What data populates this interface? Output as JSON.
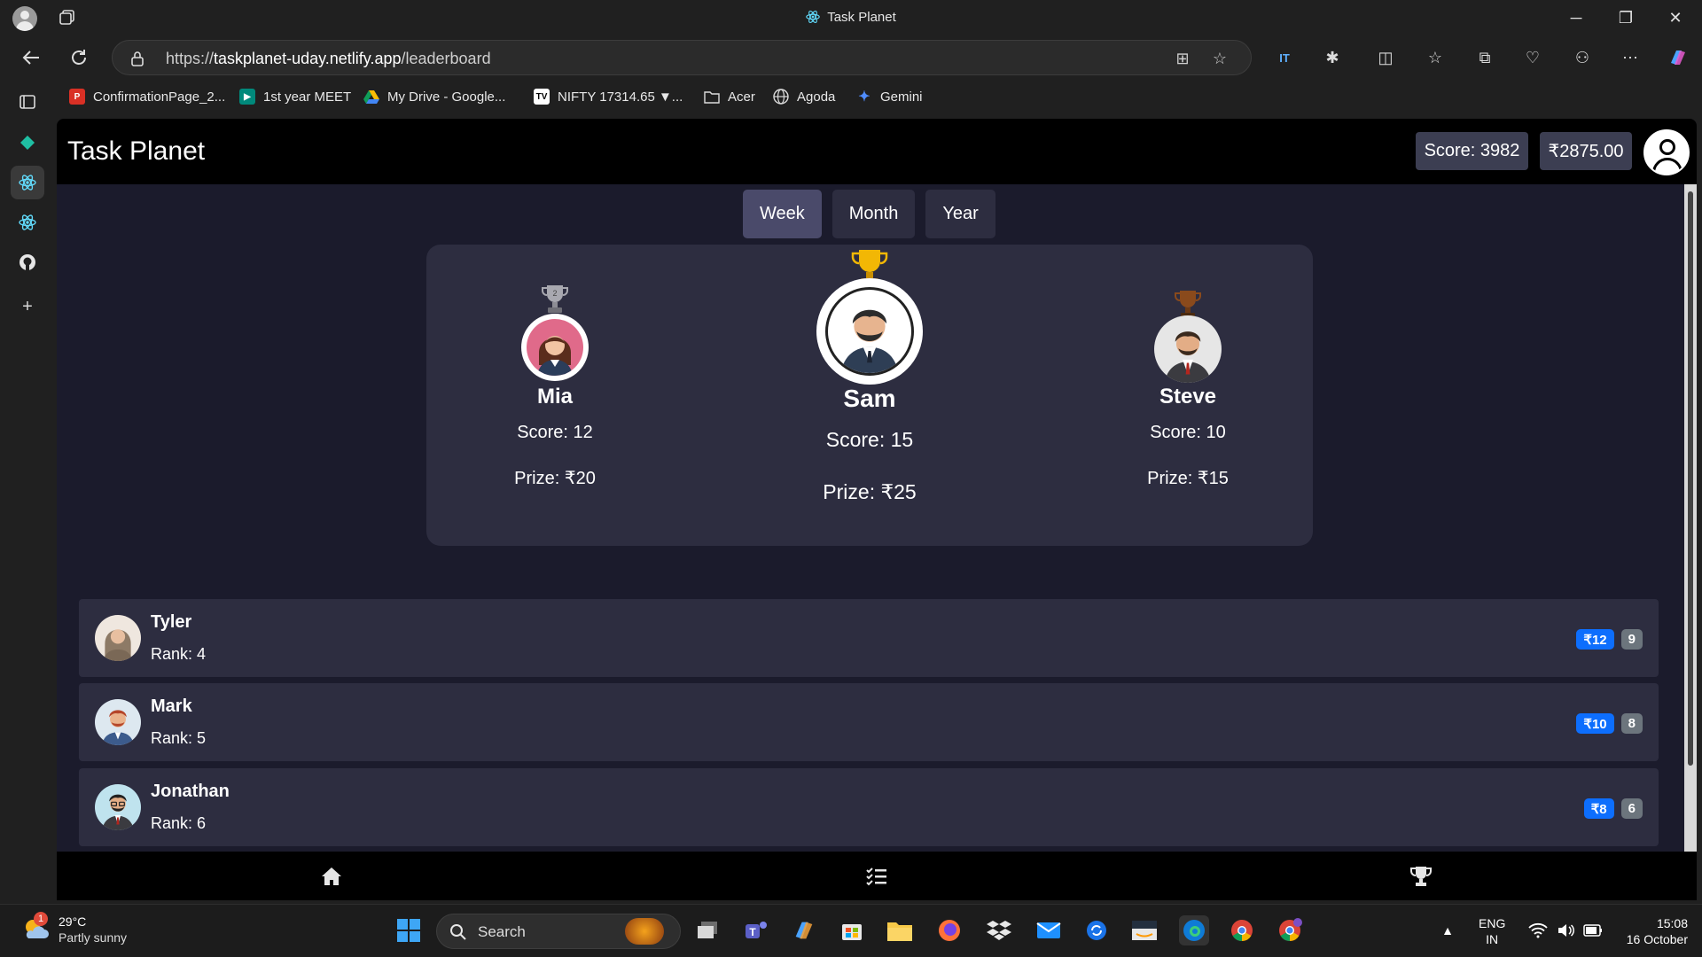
{
  "window": {
    "title": "Task Planet"
  },
  "address_bar": {
    "url_scheme": "https://",
    "url_host": "taskplanet-uday.netlify.app",
    "url_path": "/leaderboard"
  },
  "bookmarks": [
    {
      "label": "ConfirmationPage_2...",
      "icon": "pdf-icon",
      "color": "#d93025"
    },
    {
      "label": "1st year MEET",
      "icon": "meet-icon",
      "color": "#00897b"
    },
    {
      "label": "My Drive - Google...",
      "icon": "google-drive-icon",
      "color": "#fbbc04"
    },
    {
      "label": "NIFTY 17314.65 ▼...",
      "icon": "tradingview-icon",
      "color": "#ffffff"
    },
    {
      "label": "Acer",
      "icon": "folder-icon",
      "color": "#dcdcdc"
    },
    {
      "label": "Agoda",
      "icon": "globe-icon",
      "color": "#dcdcdc"
    },
    {
      "label": "Gemini",
      "icon": "gemini-icon",
      "color": "#4f8cff"
    }
  ],
  "app": {
    "brand": "Task Planet",
    "score_label": "Score: 3982",
    "balance_label": "₹2875.00",
    "accent": "#4a4a6a"
  },
  "tabs": [
    {
      "label": "Week",
      "active": true
    },
    {
      "label": "Month",
      "active": false
    },
    {
      "label": "Year",
      "active": false
    }
  ],
  "podium": {
    "first": {
      "name": "Sam",
      "score": "Score: 15",
      "prize": "Prize: ₹25",
      "trophy": "gold-trophy-icon"
    },
    "second": {
      "name": "Mia",
      "score": "Score: 12",
      "prize": "Prize: ₹20",
      "trophy": "silver-trophy-icon"
    },
    "third": {
      "name": "Steve",
      "score": "Score: 10",
      "prize": "Prize: ₹15",
      "trophy": "bronze-trophy-icon"
    }
  },
  "leaderboard_rows": [
    {
      "name": "Tyler",
      "rank": "Rank: 4",
      "prize": "₹12",
      "score": "9"
    },
    {
      "name": "Mark",
      "rank": "Rank: 5",
      "prize": "₹10",
      "score": "8"
    },
    {
      "name": "Jonathan",
      "rank": "Rank: 6",
      "prize": "₹8",
      "score": "6"
    }
  ],
  "bottom_nav": [
    "home-icon",
    "task-list-icon",
    "trophy-icon"
  ],
  "taskbar": {
    "weather_temp": "29°C",
    "weather_desc": "Partly sunny",
    "weather_badge": "1",
    "search_label": "Search",
    "lang_1": "ENG",
    "lang_2": "IN",
    "time": "15:08",
    "date": "16 October"
  }
}
